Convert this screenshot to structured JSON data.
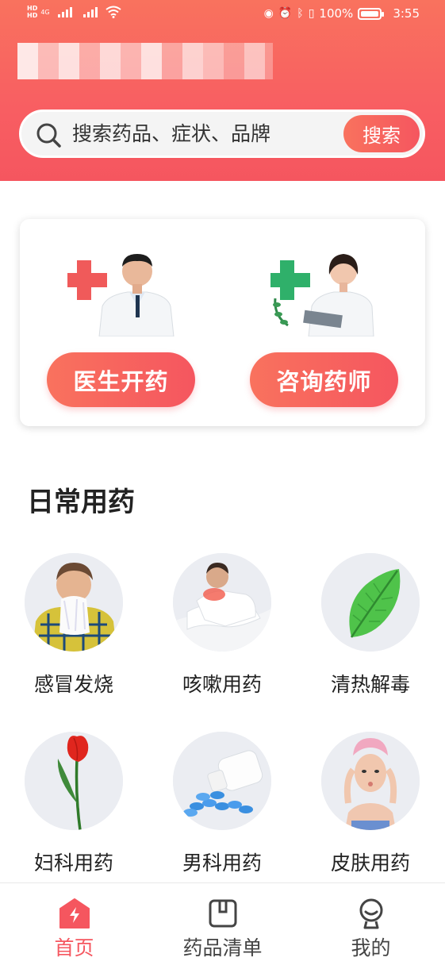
{
  "status_bar": {
    "network": "4G",
    "battery": "100%",
    "time": "3:55"
  },
  "header": {
    "store_name": ""
  },
  "search": {
    "placeholder": "搜索药品、症状、品牌",
    "button_label": "搜索"
  },
  "actions": {
    "prescribe_label": "医生开药",
    "consult_label": "咨询药师"
  },
  "daily": {
    "title": "日常用药",
    "items": [
      {
        "label": "感冒发烧",
        "icon": "cold-fever-image"
      },
      {
        "label": "咳嗽用药",
        "icon": "cough-image"
      },
      {
        "label": "清热解毒",
        "icon": "leaf-image"
      },
      {
        "label": "妇科用药",
        "icon": "tulip-image"
      },
      {
        "label": "男科用药",
        "icon": "pills-image"
      },
      {
        "label": "皮肤用药",
        "icon": "skin-care-image"
      }
    ]
  },
  "bottom_nav": {
    "items": [
      {
        "label": "首页",
        "icon": "home-icon",
        "active": true
      },
      {
        "label": "药品清单",
        "icon": "list-icon",
        "active": false
      },
      {
        "label": "我的",
        "icon": "profile-icon",
        "active": false
      }
    ]
  },
  "colors": {
    "brand_red": "#f5565f",
    "brand_orange": "#f9725e",
    "circle_bg": "#ebedf2"
  }
}
